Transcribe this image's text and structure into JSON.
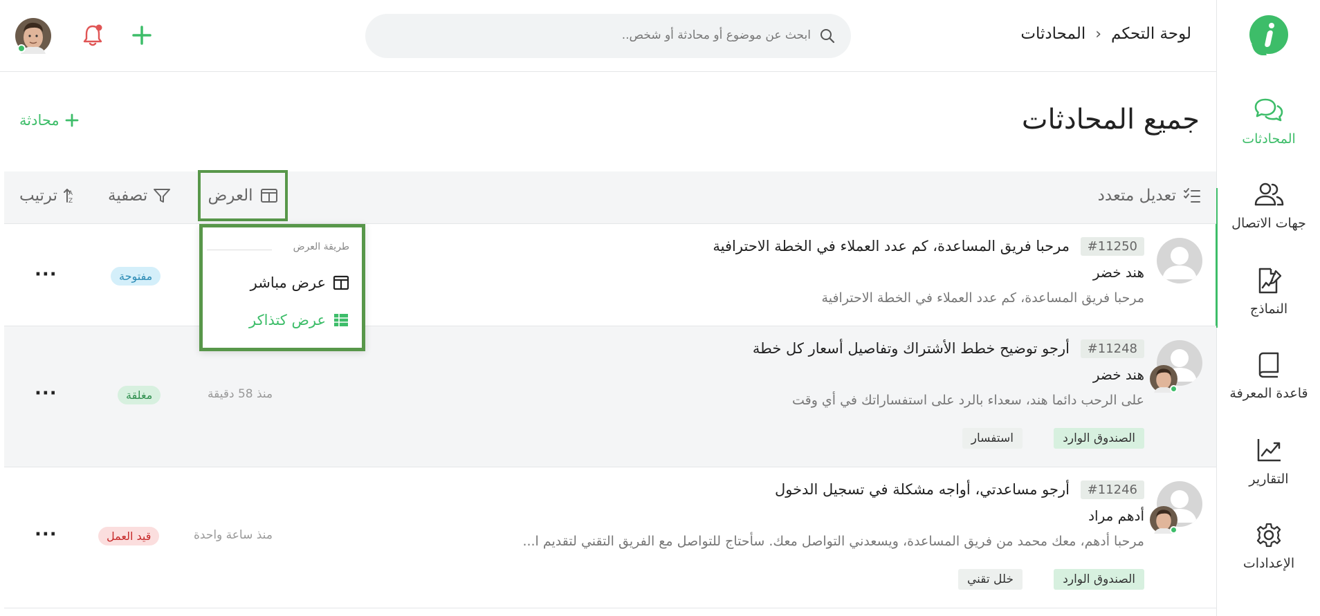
{
  "sidebar": {
    "items": [
      {
        "label": "المحادثات",
        "icon": "chat-bubbles-icon",
        "active": true
      },
      {
        "label": "جهات الاتصال",
        "icon": "contacts-icon",
        "active": false
      },
      {
        "label": "النماذج",
        "icon": "form-chart-icon",
        "active": false
      },
      {
        "label": "قاعدة المعرفة",
        "icon": "book-icon",
        "active": false
      },
      {
        "label": "التقارير",
        "icon": "trend-chart-icon",
        "active": false
      },
      {
        "label": "الإعدادات",
        "icon": "gear-icon",
        "active": false
      }
    ],
    "accent": "#3dbd69"
  },
  "header": {
    "breadcrumb": {
      "root": "لوحة التحكم",
      "current": "المحادثات"
    },
    "search_placeholder": "ابحث عن موضوع أو محادثة أو شخص.."
  },
  "page": {
    "title": "جميع المحادثات",
    "new_conversation_label": "محادثة"
  },
  "toolbar": {
    "bulk_edit": "تعديل متعدد",
    "view": "العرض",
    "filter": "تصفية",
    "sort": "ترتيب"
  },
  "view_dropdown": {
    "heading": "طريقة العرض",
    "options": [
      {
        "label": "عرض مباشر",
        "icon": "columns-icon",
        "selected": false
      },
      {
        "label": "عرض كتذاكر",
        "icon": "table-icon",
        "selected": true
      }
    ]
  },
  "conversations": [
    {
      "ticket": "#11250",
      "subject": "مرحبا فريق المساعدة، كم عدد العملاء في الخطة الاحترافية",
      "name": "هند خضر",
      "preview": "مرحبا فريق المساعدة، كم عدد العملاء في الخطة الاحترافية",
      "status": "مفتوحة",
      "time": "",
      "tags": []
    },
    {
      "ticket": "#11248",
      "subject": "أرجو توضيح خطط الأشتراك وتفاصيل أسعار كل خطة",
      "name": "هند خضر",
      "preview": "على الرحب دائما هند، سعداء بالرد على استفساراتك في أي وقت",
      "status": "مغلقة",
      "time": "منذ 58 دقيقة",
      "tags": [
        "الصندوق الوارد",
        "استفسار"
      ]
    },
    {
      "ticket": "#11246",
      "subject": "أرجو مساعدتي، أواجه مشكلة في تسجيل الدخول",
      "name": "أدهم مراد",
      "preview": "مرحبا أدهم، معك محمد من فريق المساعدة، ويسعدني التواصل معك. سأحتاج للتواصل مع الفريق التقني لتقديم ا...",
      "status": "قيد العمل",
      "time": "منذ ساعة واحدة",
      "tags": [
        "الصندوق الوارد",
        "خلل تقني"
      ]
    }
  ],
  "colors": {
    "status_open_bg": "#d4effa",
    "status_open_fg": "#2b8bb5",
    "status_closed_bg": "#d7f0df",
    "status_closed_fg": "#2f8f4e",
    "status_progress_bg": "#fbdede",
    "status_progress_fg": "#c62828",
    "highlight_border": "#58974a"
  }
}
